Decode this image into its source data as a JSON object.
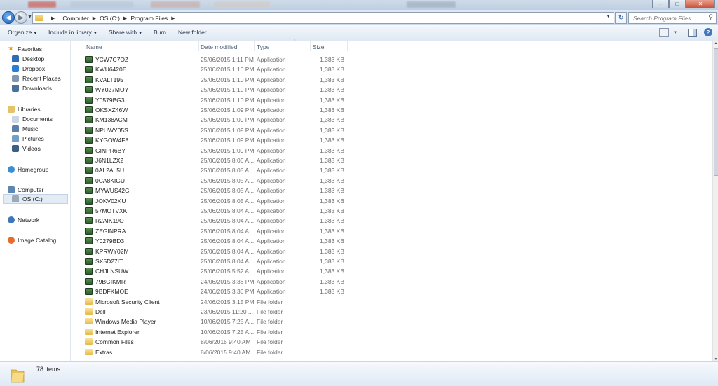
{
  "window": {
    "colors": {
      "titlebar": "#cfdbe8",
      "accent": "#3f77c0"
    }
  },
  "address": {
    "crumbs": [
      "Computer",
      "OS (C:)",
      "Program Files"
    ]
  },
  "search": {
    "placeholder": "Search Program Files"
  },
  "toolbar": {
    "organize": "Organize",
    "include_in_library": "Include in library",
    "share_with": "Share with",
    "burn": "Burn",
    "new_folder": "New folder"
  },
  "nav": {
    "favorites": "Favorites",
    "desktop": "Desktop",
    "dropbox": "Dropbox",
    "recent_places": "Recent Places",
    "downloads": "Downloads",
    "libraries": "Libraries",
    "documents": "Documents",
    "music": "Music",
    "pictures": "Pictures",
    "videos": "Videos",
    "homegroup": "Homegroup",
    "computer": "Computer",
    "os_c": "OS (C:)",
    "network": "Network",
    "image_catalog": "Image Catalog"
  },
  "columns": {
    "name": "Name",
    "date_modified": "Date modified",
    "type": "Type",
    "size": "Size"
  },
  "files": [
    {
      "name": "YCW7C7OZ",
      "date": "25/06/2015 1:11 PM",
      "type": "Application",
      "size": "1,383 KB",
      "icon": "app"
    },
    {
      "name": "KWU6420E",
      "date": "25/06/2015 1:10 PM",
      "type": "Application",
      "size": "1,383 KB",
      "icon": "app"
    },
    {
      "name": "KVALT195",
      "date": "25/06/2015 1:10 PM",
      "type": "Application",
      "size": "1,383 KB",
      "icon": "app"
    },
    {
      "name": "WY027MOY",
      "date": "25/06/2015 1:10 PM",
      "type": "Application",
      "size": "1,383 KB",
      "icon": "app"
    },
    {
      "name": "Y0579BG3",
      "date": "25/06/2015 1:10 PM",
      "type": "Application",
      "size": "1,383 KB",
      "icon": "app"
    },
    {
      "name": "OKSXZ46W",
      "date": "25/06/2015 1:09 PM",
      "type": "Application",
      "size": "1,383 KB",
      "icon": "app"
    },
    {
      "name": "KM138ACM",
      "date": "25/06/2015 1:09 PM",
      "type": "Application",
      "size": "1,383 KB",
      "icon": "app"
    },
    {
      "name": "NPUWY05S",
      "date": "25/06/2015 1:09 PM",
      "type": "Application",
      "size": "1,383 KB",
      "icon": "app"
    },
    {
      "name": "KYGOW4F8",
      "date": "25/06/2015 1:09 PM",
      "type": "Application",
      "size": "1,383 KB",
      "icon": "app"
    },
    {
      "name": "GINPR6BY",
      "date": "25/06/2015 1:09 PM",
      "type": "Application",
      "size": "1,383 KB",
      "icon": "app"
    },
    {
      "name": "J6N1LZX2",
      "date": "25/06/2015 8:06 A...",
      "type": "Application",
      "size": "1,383 KB",
      "icon": "app"
    },
    {
      "name": "0AL2AL5U",
      "date": "25/06/2015 8:05 A...",
      "type": "Application",
      "size": "1,383 KB",
      "icon": "app"
    },
    {
      "name": "0CA8KIGU",
      "date": "25/06/2015 8:05 A...",
      "type": "Application",
      "size": "1,383 KB",
      "icon": "app"
    },
    {
      "name": "MYWUS42G",
      "date": "25/06/2015 8:05 A...",
      "type": "Application",
      "size": "1,383 KB",
      "icon": "app"
    },
    {
      "name": "JOKV02KU",
      "date": "25/06/2015 8:05 A...",
      "type": "Application",
      "size": "1,383 KB",
      "icon": "app"
    },
    {
      "name": "57MOTVXK",
      "date": "25/06/2015 8:04 A...",
      "type": "Application",
      "size": "1,383 KB",
      "icon": "app"
    },
    {
      "name": "R2AIK19O",
      "date": "25/06/2015 8:04 A...",
      "type": "Application",
      "size": "1,383 KB",
      "icon": "app"
    },
    {
      "name": "ZEGINPRA",
      "date": "25/06/2015 8:04 A...",
      "type": "Application",
      "size": "1,383 KB",
      "icon": "app"
    },
    {
      "name": "Y0279BD3",
      "date": "25/06/2015 8:04 A...",
      "type": "Application",
      "size": "1,383 KB",
      "icon": "app"
    },
    {
      "name": "KPRWY02M",
      "date": "25/06/2015 8:04 A...",
      "type": "Application",
      "size": "1,383 KB",
      "icon": "app"
    },
    {
      "name": "SX5D27IT",
      "date": "25/06/2015 8:04 A...",
      "type": "Application",
      "size": "1,383 KB",
      "icon": "app"
    },
    {
      "name": "CHJLNSUW",
      "date": "25/06/2015 5:52 A...",
      "type": "Application",
      "size": "1,383 KB",
      "icon": "app"
    },
    {
      "name": "79BGIKMR",
      "date": "24/06/2015 3:36 PM",
      "type": "Application",
      "size": "1,383 KB",
      "icon": "app"
    },
    {
      "name": "9BDFKMOE",
      "date": "24/06/2015 3:36 PM",
      "type": "Application",
      "size": "1,383 KB",
      "icon": "app"
    },
    {
      "name": "Microsoft Security Client",
      "date": "24/06/2015 3:15 PM",
      "type": "File folder",
      "size": "",
      "icon": "folder"
    },
    {
      "name": "Dell",
      "date": "23/06/2015 11:20 ...",
      "type": "File folder",
      "size": "",
      "icon": "folder"
    },
    {
      "name": "Windows Media Player",
      "date": "10/06/2015 7:25 A...",
      "type": "File folder",
      "size": "",
      "icon": "folder"
    },
    {
      "name": "Internet Explorer",
      "date": "10/06/2015 7:25 A...",
      "type": "File folder",
      "size": "",
      "icon": "folder"
    },
    {
      "name": "Common Files",
      "date": "8/06/2015 9:40 AM",
      "type": "File folder",
      "size": "",
      "icon": "folder"
    },
    {
      "name": "Extras",
      "date": "8/06/2015 9:40 AM",
      "type": "File folder",
      "size": "",
      "icon": "folder"
    }
  ],
  "status": {
    "item_count": "78 items"
  }
}
